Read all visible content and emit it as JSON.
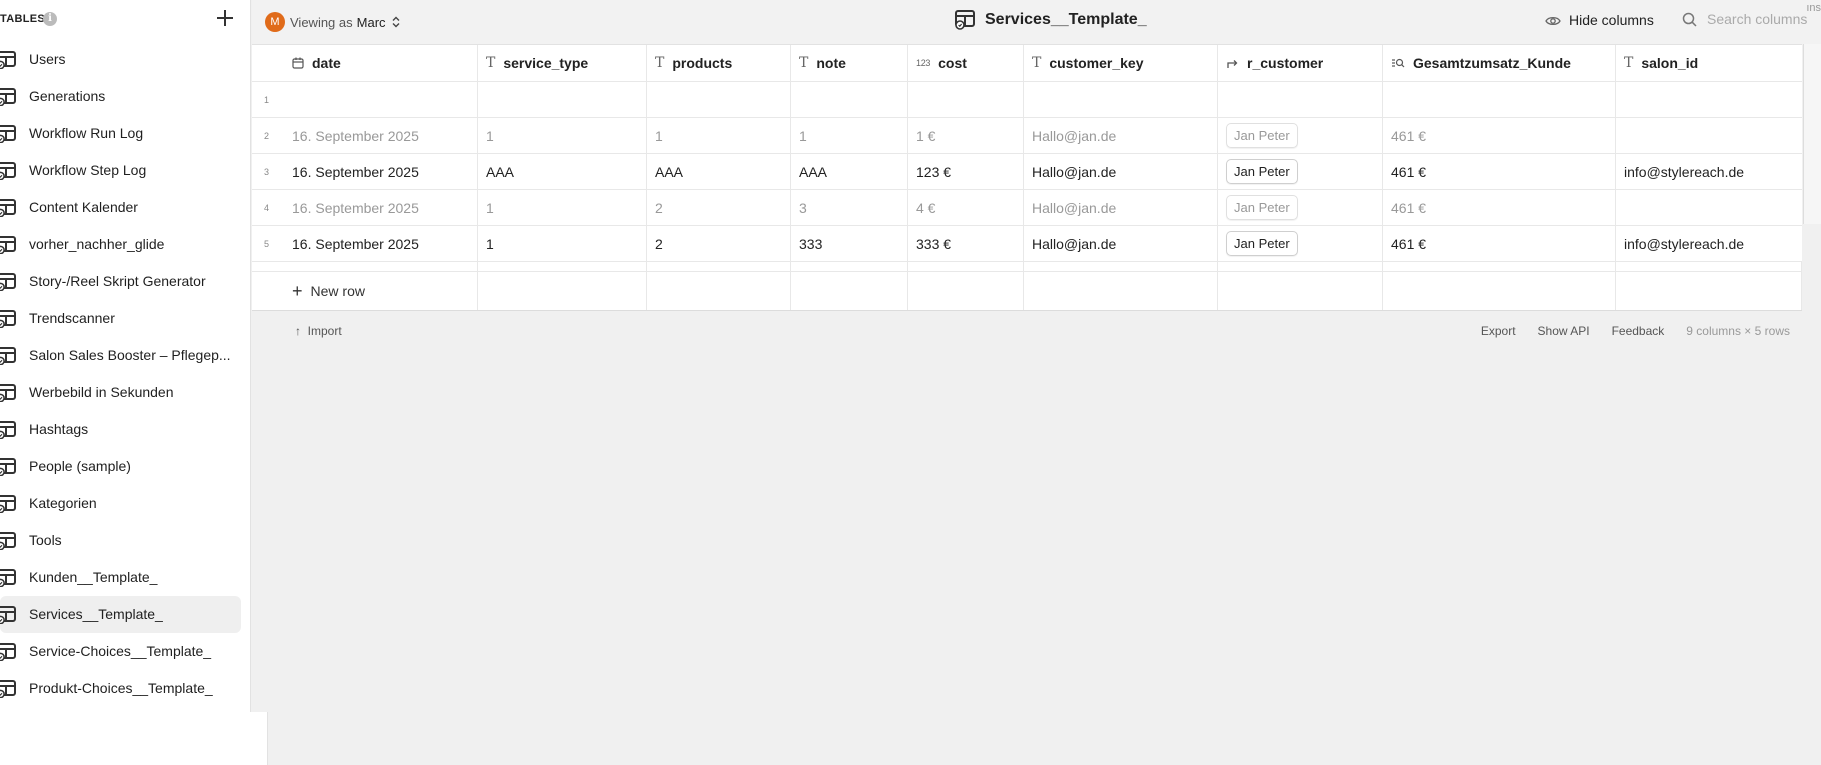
{
  "sidebar": {
    "title": "TABLES",
    "info_icon": "i",
    "items": [
      {
        "label": "Users"
      },
      {
        "label": "Generations"
      },
      {
        "label": "Workflow Run Log"
      },
      {
        "label": "Workflow Step Log"
      },
      {
        "label": "Content Kalender"
      },
      {
        "label": "vorher_nachher_glide"
      },
      {
        "label": "Story-/Reel Skript Generator"
      },
      {
        "label": "Trendscanner"
      },
      {
        "label": "Salon Sales Booster – Pflegep..."
      },
      {
        "label": "Werbebild in Sekunden"
      },
      {
        "label": "Hashtags"
      },
      {
        "label": "People (sample)"
      },
      {
        "label": "Kategorien"
      },
      {
        "label": "Tools"
      },
      {
        "label": "Kunden__Template_"
      },
      {
        "label": "Services__Template_",
        "active": true
      },
      {
        "label": "Service-Choices__Template_"
      },
      {
        "label": "Produkt-Choices__Template_"
      }
    ]
  },
  "topbar": {
    "avatar_letter": "M",
    "viewing_label": "Viewing as",
    "viewing_user": "Marc",
    "title": "Services__Template_",
    "hide_columns": "Hide columns",
    "search_placeholder": "Search columns",
    "corner_text": "ıns"
  },
  "grid": {
    "columns": [
      {
        "icon": "calendar-icon",
        "name": "date"
      },
      {
        "icon": "text-icon",
        "name": "service_type"
      },
      {
        "icon": "text-icon",
        "name": "products"
      },
      {
        "icon": "text-icon",
        "name": "note"
      },
      {
        "icon": "number-icon",
        "name": "cost"
      },
      {
        "icon": "text-icon",
        "name": "customer_key"
      },
      {
        "icon": "relation-icon",
        "name": "r_customer"
      },
      {
        "icon": "lookup-icon",
        "name": "Gesamtzumsatz_Kunde"
      },
      {
        "icon": "text-icon",
        "name": "salon_id"
      }
    ],
    "rows": [
      {
        "num": "1",
        "faded": false,
        "cells": [
          "",
          "",
          "",
          "",
          "",
          "",
          "",
          "",
          ""
        ]
      },
      {
        "num": "2",
        "faded": true,
        "cells": [
          "16. September 2025",
          "1",
          "1",
          "1",
          "1 €",
          "Hallo@jan.de",
          "Jan Peter",
          "461 €",
          ""
        ]
      },
      {
        "num": "3",
        "faded": false,
        "cells": [
          "16. September 2025",
          "AAA",
          "AAA",
          "AAA",
          "123 €",
          "Hallo@jan.de",
          "Jan Peter",
          "461 €",
          "info@stylereach.de"
        ]
      },
      {
        "num": "4",
        "faded": true,
        "cells": [
          "16. September 2025",
          "1",
          "2",
          "3",
          "4 €",
          "Hallo@jan.de",
          "Jan Peter",
          "461 €",
          ""
        ]
      },
      {
        "num": "5",
        "faded": false,
        "cells": [
          "16. September 2025",
          "1",
          "2",
          "333",
          "333 €",
          "Hallo@jan.de",
          "Jan Peter",
          "461 €",
          "info@stylereach.de"
        ]
      }
    ],
    "new_row": "New row"
  },
  "footer": {
    "import": "Import",
    "export": "Export",
    "show_api": "Show API",
    "feedback": "Feedback",
    "summary": "9 columns × 5 rows"
  }
}
